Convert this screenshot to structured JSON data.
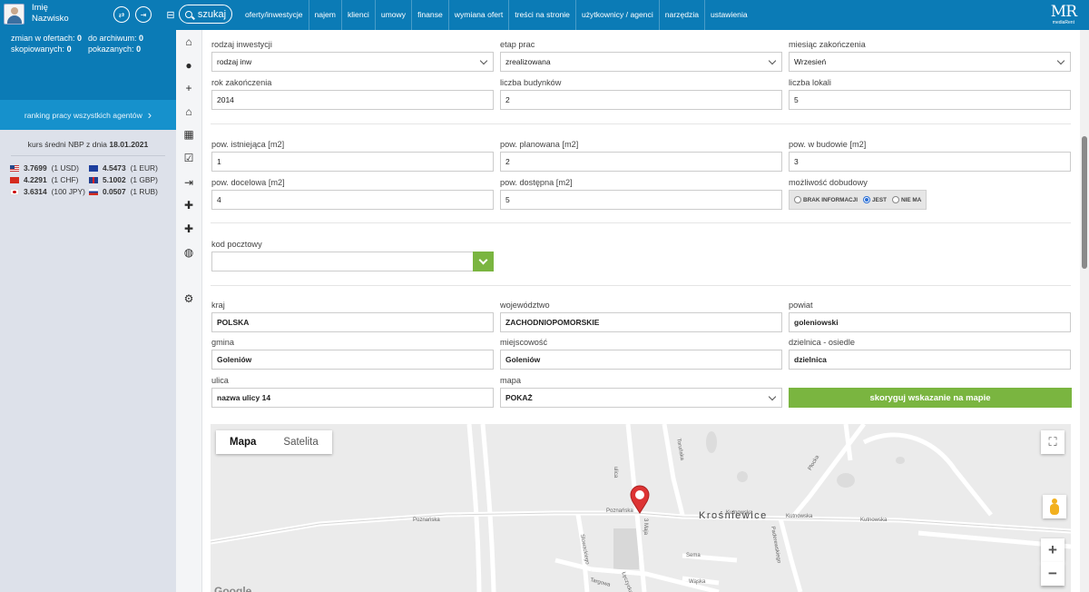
{
  "user": {
    "first_name": "Imię",
    "last_name": "Nazwisko"
  },
  "search": {
    "label": "szukaj"
  },
  "nav": [
    "oferty/inwestycje",
    "najem",
    "klienci",
    "umowy",
    "finanse",
    "wymiana ofert",
    "treści na stronie",
    "użytkownicy / agenci",
    "narzędzia",
    "ustawienia"
  ],
  "logo": {
    "mark": "MR",
    "sub": "mediaRent"
  },
  "stats": {
    "changes_label": "zmian w ofertach:",
    "changes_value": "0",
    "archive_label": "do archiwum:",
    "archive_value": "0",
    "copied_label": "skopiowanych:",
    "copied_value": "0",
    "shown_label": "pokazanych:",
    "shown_value": "0"
  },
  "ranking": {
    "label": "ranking pracy wszystkich agentów",
    "arrow": "›"
  },
  "kurs": {
    "prefix": "kurs średni NBP z dnia",
    "date": "18.01.2021"
  },
  "rates": [
    {
      "value": "3.7699",
      "unit": "(1 USD)",
      "flag": "usd"
    },
    {
      "value": "4.5473",
      "unit": "(1 EUR)",
      "flag": "eur"
    },
    {
      "value": "4.2291",
      "unit": "(1 CHF)",
      "flag": "chf"
    },
    {
      "value": "5.1002",
      "unit": "(1 GBP)",
      "flag": "gbp"
    },
    {
      "value": "3.6314",
      "unit": "(100 JPY)",
      "flag": "jpy"
    },
    {
      "value": "0.0507",
      "unit": "(1 RUB)",
      "flag": "rub"
    }
  ],
  "icon_column": [
    {
      "name": "home-icon",
      "glyph": "⌂"
    },
    {
      "name": "user-icon",
      "glyph": "●"
    },
    {
      "name": "user-plus-icon",
      "glyph": "+"
    },
    {
      "name": "house-icon",
      "glyph": "⌂"
    },
    {
      "name": "calendar-icon",
      "glyph": "▦"
    },
    {
      "name": "checklist-icon",
      "glyph": "☑"
    },
    {
      "name": "sign-out-icon",
      "glyph": "⇥"
    },
    {
      "name": "plus-icon",
      "glyph": "✚"
    },
    {
      "name": "plus-icon",
      "glyph": "✚"
    },
    {
      "name": "globe-icon",
      "glyph": "◍"
    },
    {
      "name": "cogs-icon",
      "glyph": "⚙"
    }
  ],
  "form": {
    "rodzaj": {
      "label": "rodzaj inwestycji",
      "value": "rodzaj inw"
    },
    "etap": {
      "label": "etap prac",
      "value": "zrealizowana"
    },
    "miesiac": {
      "label": "miesiąc zakończenia",
      "value": "Wrzesień"
    },
    "rok": {
      "label": "rok zakończenia",
      "value": "2014"
    },
    "budynki": {
      "label": "liczba budynków",
      "value": "2"
    },
    "lokale": {
      "label": "liczba lokali",
      "value": "5"
    },
    "pow_ist": {
      "label": "pow. istniejąca [m2]",
      "value": "1"
    },
    "pow_plan": {
      "label": "pow. planowana [m2]",
      "value": "2"
    },
    "pow_bud": {
      "label": "pow. w budowie [m2]",
      "value": "3"
    },
    "pow_doc": {
      "label": "pow. docelowa [m2]",
      "value": "4"
    },
    "pow_dost": {
      "label": "pow. dostępna [m2]",
      "value": "5"
    },
    "dobudowa": {
      "label": "możliwość dobudowy",
      "opt1": "BRAK INFORMACJI",
      "opt2": "JEST",
      "opt3": "NIE MA",
      "selected": "JEST"
    },
    "kod": {
      "label": "kod pocztowy",
      "value": ""
    },
    "kraj": {
      "label": "kraj",
      "value": "POLSKA"
    },
    "woj": {
      "label": "województwo",
      "value": "ZACHODNIOPOMORSKIE"
    },
    "powiat": {
      "label": "powiat",
      "value": "goleniowski"
    },
    "gmina": {
      "label": "gmina",
      "value": "Goleniów"
    },
    "miejsc": {
      "label": "miejscowość",
      "value": "Goleniów"
    },
    "dzielnica": {
      "label": "dzielnica - osiedle",
      "value": "dzielnica"
    },
    "ulica": {
      "label": "ulica",
      "value": "nazwa ulicy 14"
    },
    "mapa": {
      "label": "mapa",
      "value": "POKAŻ"
    },
    "correct_button": "skoryguj wskazanie na mapie"
  },
  "map": {
    "tab_map": "Mapa",
    "tab_satellite": "Satelita",
    "active_tab": "Mapa",
    "town": "Krośniewice",
    "streets": [
      "Poznańska",
      "Poznańska",
      "ulica",
      "Toruńska",
      "Kutnowska",
      "Kutnowska",
      "Kutnowska",
      "Płocka",
      "Paderewskiego",
      "Słowackiego",
      "Sema",
      "Wąska",
      "3 Maja",
      "Targowa",
      "Łęczycka"
    ],
    "zoom_in": "+",
    "zoom_out": "−",
    "attribution": "Google"
  }
}
